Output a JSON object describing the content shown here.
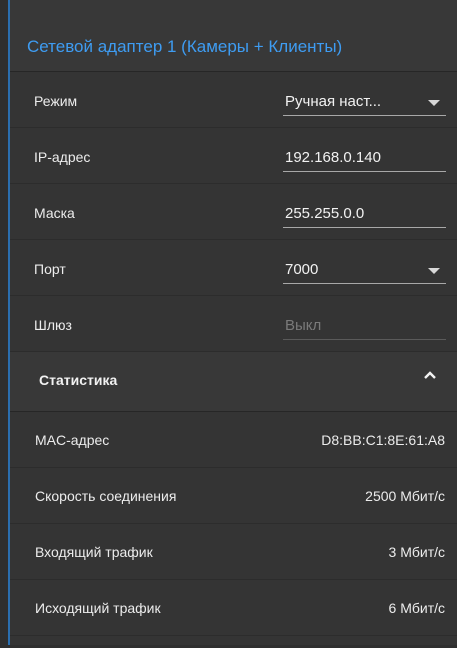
{
  "panel": {
    "title": "Сетевой адаптер 1 (Камеры + Клиенты)",
    "accent_color": "#3e9cf2"
  },
  "settings": {
    "mode": {
      "label": "Режим",
      "value": "Ручная наст..."
    },
    "ip": {
      "label": "IP-адрес",
      "value": "192.168.0.140"
    },
    "mask": {
      "label": "Маска",
      "value": "255.255.0.0"
    },
    "port": {
      "label": "Порт",
      "value": "7000"
    },
    "gateway": {
      "label": "Шлюз",
      "value": "Выкл"
    }
  },
  "statistics": {
    "title": "Статистика",
    "rows": [
      {
        "label": "MAC-адрес",
        "value": "D8:BB:C1:8E:61:A8"
      },
      {
        "label": "Скорость соединения",
        "value": "2500 Мбит/с"
      },
      {
        "label": "Входящий трафик",
        "value": "3 Мбит/с"
      },
      {
        "label": "Исходящий трафик",
        "value": "6 Мбит/с"
      }
    ]
  }
}
